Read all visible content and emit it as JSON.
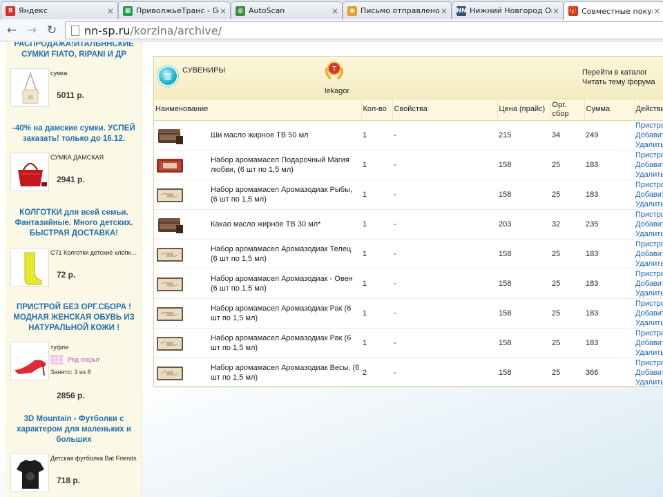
{
  "browser": {
    "tabs": [
      {
        "title": "Яндекс",
        "icon": "yandex-icon",
        "color": "#e52620",
        "glyph": "Я"
      },
      {
        "title": "ПриволжьеТранс - Goo",
        "icon": "spreadsheet-icon",
        "color": "#1f9e4a",
        "glyph": "▦"
      },
      {
        "title": "AutoScan",
        "icon": "globe-icon",
        "color": "#3d8f3d",
        "glyph": "◍"
      },
      {
        "title": "Письмо отправлено -",
        "icon": "mail-icon",
        "color": "#e2a21c",
        "glyph": "◉"
      },
      {
        "title": "Нижний Новгород Он",
        "icon": "nn-icon",
        "color": "#35516d",
        "glyph": "NN"
      },
      {
        "title": "Совместные покупки",
        "icon": "gift-icon",
        "color": "#d0342c",
        "glyph": "🎁"
      }
    ],
    "url": {
      "host": "nn-sp.ru",
      "path": "/korzina/archive/"
    }
  },
  "sidebar": {
    "promos": [
      {
        "title": "РАСПРОДАЖА!ИТАЛЬЯНСКИЕ СУМКИ FIATO, RIPANI И ДР",
        "name": "сумка",
        "price": "5011 р.",
        "thumb": "shoulder-bag"
      },
      {
        "title": "-40% на дамские сумки. УСПЕЙ заказать! только до 16.12.",
        "name": "СУМКА ДАМСКАЯ",
        "price": "2941 р.",
        "thumb": "red-handbag"
      },
      {
        "title": "КОЛГОТКИ для всей семьи. Фантазийные. Много детских. БЫСТРАЯ ДОСТАВКА!",
        "name": "C71 Колготки детские хлопковые",
        "price": "72 р.",
        "thumb": "yellow-tights"
      },
      {
        "title": "ПРИСТРОЙ БЕЗ ОРГ.СБОРА ! МОДНАЯ ЖЕНСКАЯ ОБУВЬ ИЗ НАТУРАЛЬНОЙ КОЖИ !",
        "name": "туфли",
        "status": "Ряд открыт",
        "occupied": "Занято: 3 из 8",
        "price": "2856 р.",
        "thumb": "red-shoe"
      },
      {
        "title": "3D Mountain - Футболки с характером для маленьких и больших",
        "name": "Детская футболка Bat Friends",
        "price": "718 р.",
        "thumb": "black-tshirt"
      }
    ]
  },
  "cart": {
    "category": "СУВЕНИРЫ",
    "user": "lekagor",
    "links": [
      "Перейти в каталог",
      "Читать тему форума"
    ],
    "columns": [
      "Наименование",
      "Кол-во",
      "Свойства",
      "Цена (прайс)",
      "Орг. сбор",
      "Сумма",
      "Действия"
    ],
    "actions": [
      "Пристроить",
      "Добавить",
      "Удалить"
    ],
    "items": [
      {
        "name": "Ши масло жирное ТВ 50 мл",
        "qty": "1",
        "props": "-",
        "price": "215",
        "fee": "34",
        "sum": "249",
        "thumb": "jar"
      },
      {
        "name": "Набор аромамасел Подарочный Магия любви, (6 шт по 1,5 мл)",
        "qty": "1",
        "props": "-",
        "price": "158",
        "fee": "25",
        "sum": "183",
        "thumb": "red-box"
      },
      {
        "name": "Набор аромамасел Аромазодиак Рыбы, (6 шт по 1,5 мл)",
        "qty": "1",
        "props": "-",
        "price": "158",
        "fee": "25",
        "sum": "183",
        "thumb": "zodiac-box"
      },
      {
        "name": "Какао масло жирное ТВ 30 мл*",
        "qty": "1",
        "props": "-",
        "price": "203",
        "fee": "32",
        "sum": "235",
        "thumb": "jar"
      },
      {
        "name": "Набор аромамасел Аромазодиак Телец (6 шт по 1,5 мл)",
        "qty": "1",
        "props": "-",
        "price": "158",
        "fee": "25",
        "sum": "183",
        "thumb": "zodiac-box"
      },
      {
        "name": "Набор аромамасел Аромазодиак - Овен (6 шт по 1,5 мл)",
        "qty": "1",
        "props": "-",
        "price": "158",
        "fee": "25",
        "sum": "183",
        "thumb": "zodiac-box"
      },
      {
        "name": "Набор аромамасел Аромазодиак Рак (6 шт по 1,5 мл)",
        "qty": "1",
        "props": "-",
        "price": "158",
        "fee": "25",
        "sum": "183",
        "thumb": "zodiac-box"
      },
      {
        "name": "Набор аромамасел Аромазодиак Рак (6 шт по 1,5 мл)",
        "qty": "1",
        "props": "-",
        "price": "158",
        "fee": "25",
        "sum": "183",
        "thumb": "zodiac-box"
      },
      {
        "name": "Набор аромамасел Аромазодиак Весы, (6 шт по 1,5 мл)",
        "qty": "2",
        "props": "-",
        "price": "158",
        "fee": "25",
        "sum": "366",
        "thumb": "zodiac-box"
      }
    ]
  }
}
